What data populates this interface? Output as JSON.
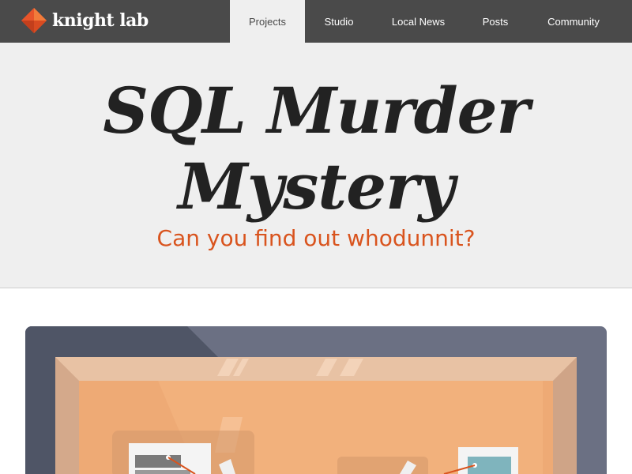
{
  "header": {
    "logo_text": "knight lab",
    "nav": [
      {
        "label": "Projects",
        "active": true
      },
      {
        "label": "Studio"
      },
      {
        "label": "Local News"
      },
      {
        "label": "Posts"
      },
      {
        "label": "Community"
      }
    ]
  },
  "hero": {
    "title_line1": "SQL Murder",
    "title_line2": "Mystery",
    "subtitle": "Can you find out whodunnit?"
  },
  "colors": {
    "topbar": "#4a4a4a",
    "hero_background": "#efefef",
    "accent": "#d9541e",
    "logo_orange": "#e8542a",
    "illustration_backdrop": "#6b7083",
    "corkboard": "#eeaa75",
    "frame": "#dbb296"
  },
  "illustration": {
    "icon": "corkboard-illustration"
  }
}
